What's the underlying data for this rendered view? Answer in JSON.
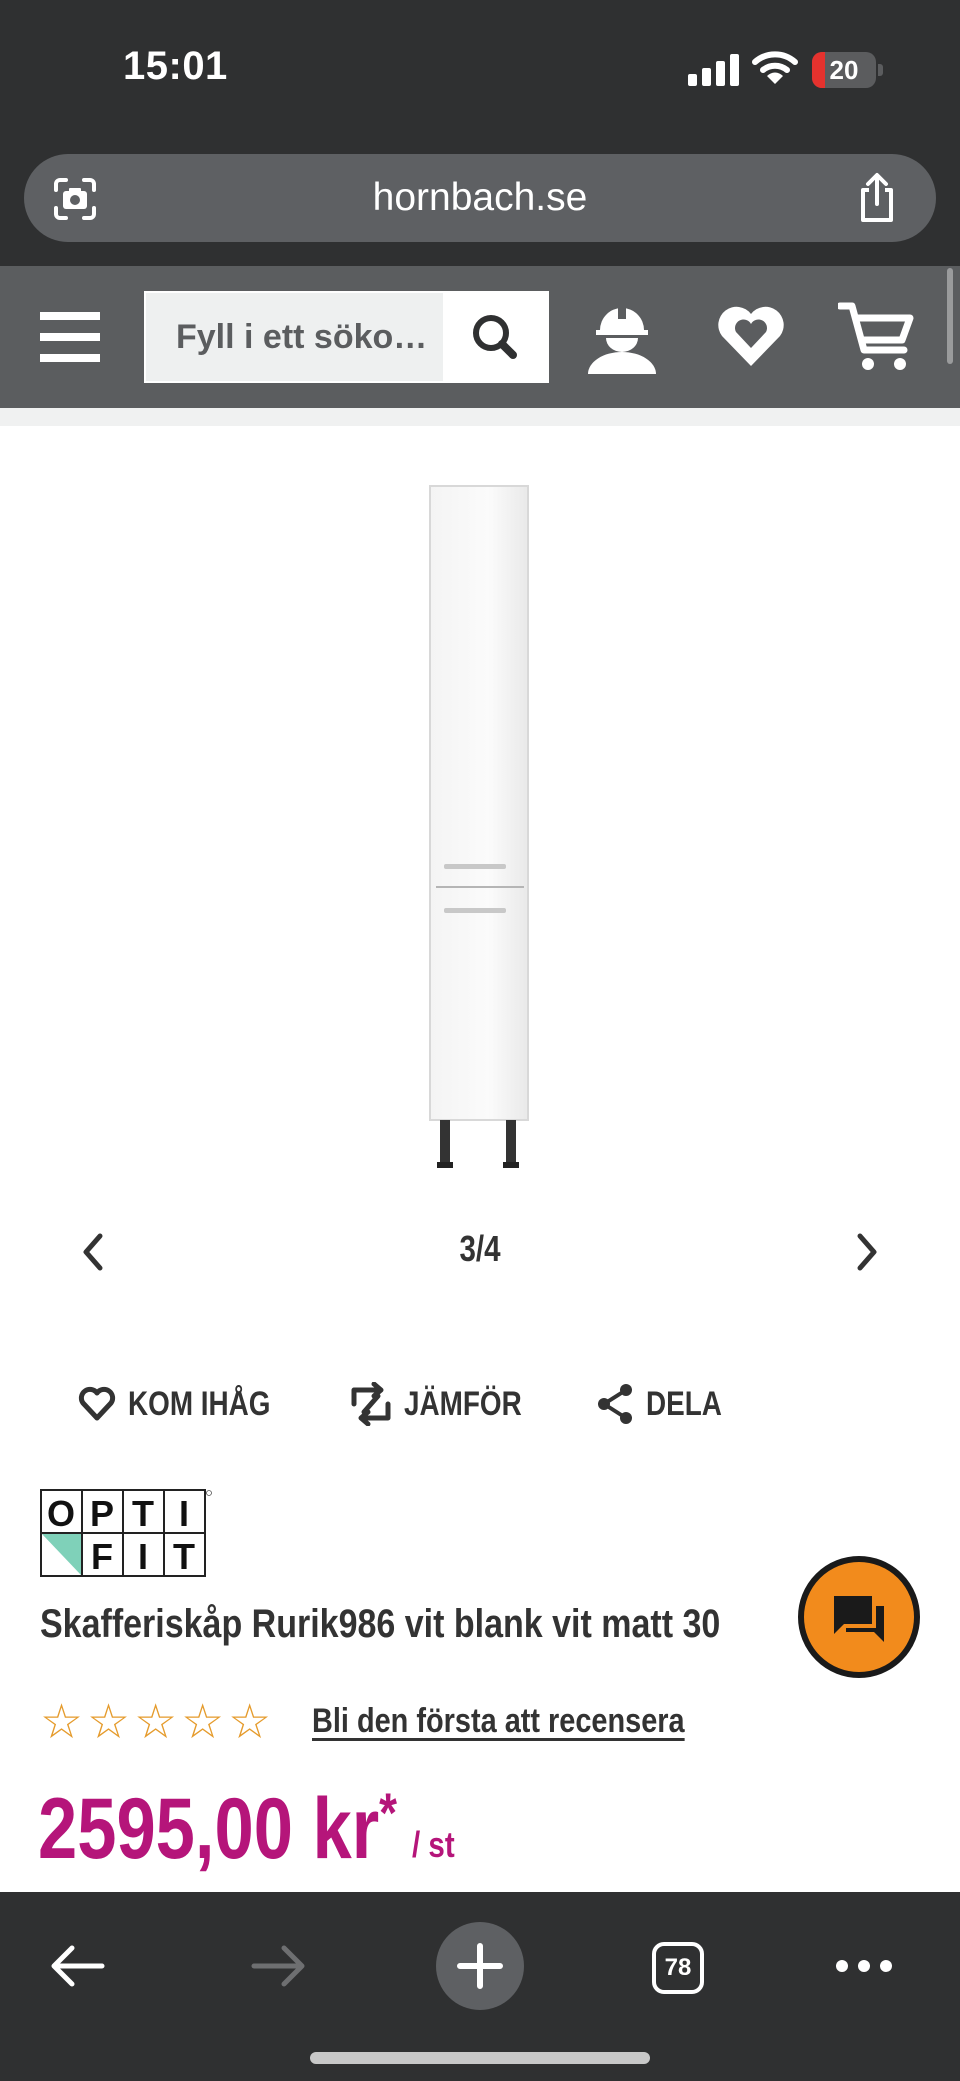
{
  "status_bar": {
    "time": "15:01",
    "battery": "20",
    "battery_level": 0.2
  },
  "browser": {
    "url": "hornbach.se",
    "tabs_count": "78"
  },
  "header": {
    "search_placeholder": "Fyll i ett söko…"
  },
  "gallery": {
    "counter": "3/4"
  },
  "actions": {
    "remember": "KOM IHÅG",
    "compare": "JÄMFÖR",
    "share": "DELA"
  },
  "product": {
    "brand": "OPTIFIT",
    "title": "Skafferiskåp Rurik986 vit blank vit matt 30",
    "rating": 0,
    "rating_max": 5,
    "review_link": "Bli den första att recensera",
    "price": "2595,00 kr",
    "price_asterisk": "*",
    "price_unit": "/ st"
  },
  "colors": {
    "price": "#b5157a",
    "header": "#5b5d5f",
    "chrome": "#2f3031",
    "star": "#e59b2c",
    "chat": "#f28b1c"
  }
}
